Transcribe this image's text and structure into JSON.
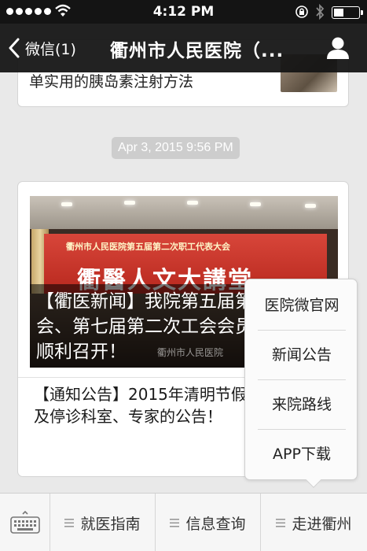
{
  "status_bar": {
    "time": "4:12 PM"
  },
  "nav": {
    "back_label": "微信(1)",
    "title": "衢州市人民医院（..."
  },
  "previous_article": {
    "title": "单实用的胰岛素注射方法"
  },
  "timestamp": "Apr 3, 2015 9:56 PM",
  "article": {
    "cover_title": "【衢医新闻】我院第五届第二次职代会、第七届第二次工会会员代表大会顺利召开！",
    "cover_banner_small": "衢州市人民医院第五届第二次职工代表大会",
    "cover_banner_big": "衢醫人文大講堂",
    "cover_watermark": "衢州市人民医院",
    "item2_title": "【通知公告】2015年清明节假期门诊安排及停诊科室、专家的公告！"
  },
  "popup_menu": {
    "items": [
      "医院微官网",
      "新闻公告",
      "来院路线",
      "APP下载"
    ]
  },
  "bottom_menu": {
    "tabs": [
      "就医指南",
      "信息查询",
      "走进衢州"
    ]
  },
  "colors": {
    "nav_bg": "#141414",
    "page_bg": "#e9e9e9",
    "banner_red": "#c8302a"
  }
}
